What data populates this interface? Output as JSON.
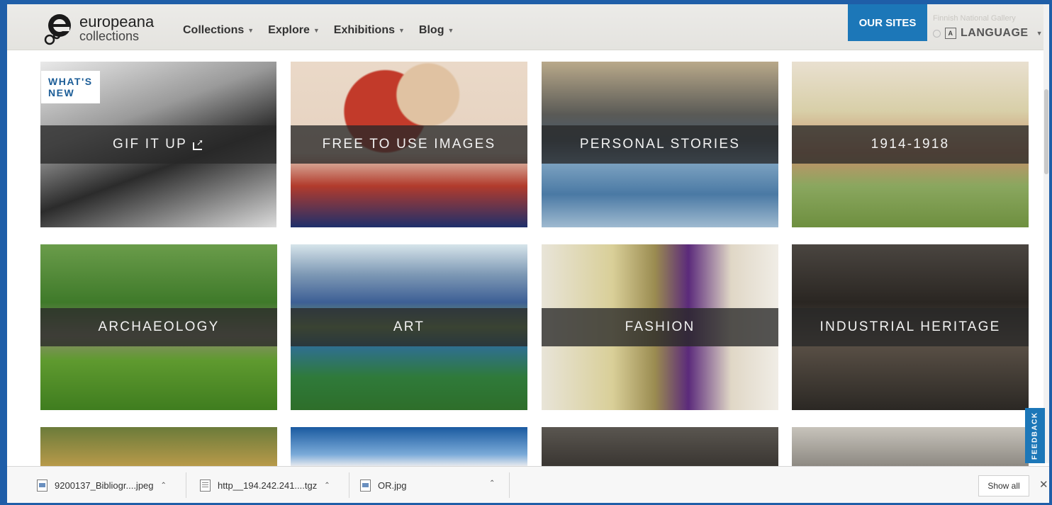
{
  "header": {
    "logo_line1": "europeana",
    "logo_line2": "collections",
    "nav": [
      {
        "label": "Collections"
      },
      {
        "label": "Explore"
      },
      {
        "label": "Exhibitions"
      },
      {
        "label": "Blog"
      }
    ],
    "our_sites_label": "OUR SITES",
    "gallery_note": "Finnish National Gallery",
    "language_label": "LANGUAGE"
  },
  "badge": "WHAT'S NEW",
  "tiles": [
    {
      "label": "GIF IT UP"
    },
    {
      "label": "FREE TO USE IMAGES"
    },
    {
      "label": "PERSONAL STORIES"
    },
    {
      "label": "1914-1918"
    },
    {
      "label": "ARCHAEOLOGY"
    },
    {
      "label": "ART"
    },
    {
      "label": "FASHION"
    },
    {
      "label": "INDUSTRIAL HERITAGE"
    }
  ],
  "feedback_label": "FEEDBACK",
  "downloads": [
    {
      "name": "9200137_Bibliogr....jpeg"
    },
    {
      "name": "http__194.242.241....tgz"
    },
    {
      "name": "OR.jpg"
    }
  ],
  "show_all_label": "Show all",
  "colors": {
    "brand_blue": "#1c77b8",
    "tile_band": "#282828"
  }
}
